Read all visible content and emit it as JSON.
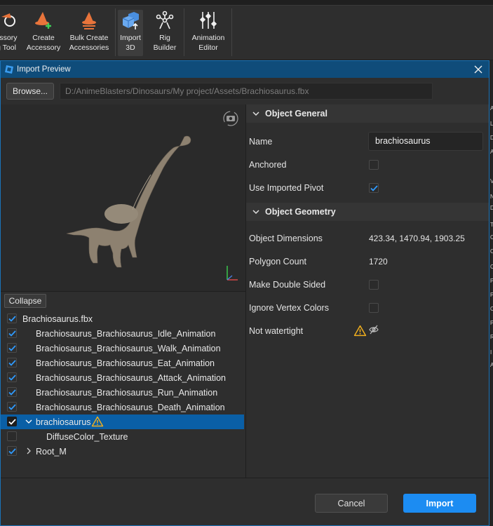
{
  "ribbon": {
    "items": [
      {
        "label1": "essory",
        "label2": "g Tool",
        "icon": "accessory-fitting-icon"
      },
      {
        "label1": "Create",
        "label2": "Accessory",
        "icon": "wizard-hat-plus-icon"
      },
      {
        "label1": "Bulk Create",
        "label2": "Accessories",
        "icon": "wizard-hat-stack-icon"
      },
      {
        "label1": "Import",
        "label2": "3D",
        "icon": "import-3d-cube-icon"
      },
      {
        "label1": "Rig",
        "label2": "Builder",
        "icon": "rig-builder-icon"
      },
      {
        "label1": "Animation",
        "label2": "Editor",
        "icon": "animation-editor-icon"
      }
    ]
  },
  "dialog": {
    "title": "Import Preview",
    "browse_label": "Browse...",
    "file_path": "D:/AnimeBlasters/Dinosaurs/My project/Assets/Brachiosaurus.fbx",
    "collapse_label": "Collapse",
    "cancel_label": "Cancel",
    "import_label": "Import",
    "accent_color": "#1c8cf2",
    "selection_color": "#0a5fa6",
    "warning_color": "#f2b01e"
  },
  "tree": [
    {
      "label": "Brachiosaurus.fbx",
      "checked": true,
      "indent": 0,
      "chevron": "none",
      "selected": false,
      "warning": false
    },
    {
      "label": "Brachiosaurus_Brachiosaurus_Idle_Animation",
      "checked": true,
      "indent": 1,
      "chevron": "none",
      "selected": false,
      "warning": false
    },
    {
      "label": "Brachiosaurus_Brachiosaurus_Walk_Animation",
      "checked": true,
      "indent": 1,
      "chevron": "none",
      "selected": false,
      "warning": false
    },
    {
      "label": "Brachiosaurus_Brachiosaurus_Eat_Animation",
      "checked": true,
      "indent": 1,
      "chevron": "none",
      "selected": false,
      "warning": false
    },
    {
      "label": "Brachiosaurus_Brachiosaurus_Attack_Animation",
      "checked": true,
      "indent": 1,
      "chevron": "none",
      "selected": false,
      "warning": false
    },
    {
      "label": "Brachiosaurus_Brachiosaurus_Run_Animation",
      "checked": true,
      "indent": 1,
      "chevron": "none",
      "selected": false,
      "warning": false
    },
    {
      "label": "Brachiosaurus_Brachiosaurus_Death_Animation",
      "checked": true,
      "indent": 1,
      "chevron": "none",
      "selected": false,
      "warning": false
    },
    {
      "label": "brachiosaurus",
      "checked": true,
      "indent": 1,
      "chevron": "down",
      "selected": true,
      "warning": true
    },
    {
      "label": "DiffuseColor_Texture",
      "checked": false,
      "indent": 2,
      "chevron": "none",
      "selected": false,
      "warning": false
    },
    {
      "label": "Root_M",
      "checked": true,
      "indent": 1,
      "chevron": "right",
      "selected": false,
      "warning": false
    }
  ],
  "properties": {
    "general_header": "Object General",
    "geometry_header": "Object Geometry",
    "name_label": "Name",
    "name_value": "brachiosaurus",
    "anchored_label": "Anchored",
    "anchored": false,
    "pivot_label": "Use Imported Pivot",
    "pivot": true,
    "dimensions_label": "Object Dimensions",
    "dimensions_value": "423.34, 1470.94, 1903.25",
    "polycount_label": "Polygon Count",
    "polycount_value": "1720",
    "double_sided_label": "Make Double Sided",
    "double_sided": false,
    "ignore_vertex_label": "Ignore Vertex Colors",
    "ignore_vertex": false,
    "watertight_label": "Not watertight"
  },
  "right_edge_chars": [
    "A",
    "L",
    "D",
    "A",
    "V",
    "N",
    "D",
    "T",
    "C",
    "O",
    "C",
    "P",
    "P",
    "C",
    "P",
    "R",
    "I",
    "A"
  ]
}
